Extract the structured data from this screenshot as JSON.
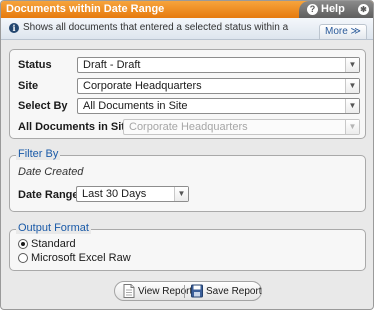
{
  "window": {
    "title": "Documents within Date Range",
    "help_label": "Help",
    "help_icon": "question-icon",
    "settings_icon": "gear-icon"
  },
  "info": {
    "icon": "info-icon",
    "text": "Shows all documents that entered a selected status within a",
    "more_label": "More ≫"
  },
  "criteria": {
    "status_label": "Status",
    "status_value": "Draft - Draft",
    "site_label": "Site",
    "site_value": "Corporate Headquarters",
    "select_by_label": "Select By",
    "select_by_value": "All Documents in Site",
    "all_docs_label": "All Documents in Site",
    "all_docs_value": "Corporate Headquarters"
  },
  "filter": {
    "legend": "Filter By",
    "field_name": "Date Created",
    "date_range_label": "Date Range",
    "date_range_value": "Last 30 Days"
  },
  "output": {
    "legend": "Output Format",
    "options": [
      {
        "label": "Standard",
        "checked": true
      },
      {
        "label": "Microsoft Excel Raw",
        "checked": false
      }
    ]
  },
  "actions": {
    "view_label": "View Report",
    "save_label": "Save Report",
    "view_icon": "document-icon",
    "save_icon": "floppy-disk-icon"
  },
  "colors": {
    "title_bar": "#f18a1c",
    "help_tab": "#6e6e6e",
    "legend_text": "#1a5aa8"
  }
}
